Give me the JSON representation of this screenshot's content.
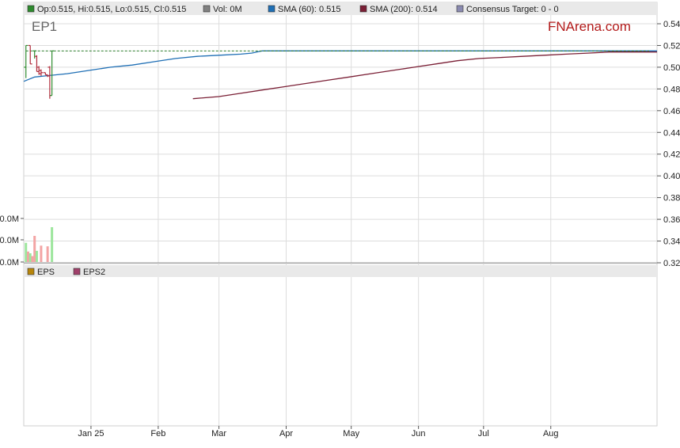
{
  "chart_data": {
    "type": "candlestick",
    "ticker": "EP1",
    "brand": "FNArena.com",
    "legend_main": [
      {
        "label": "Op:0.515, Hi:0.515, Lo:0.515, Cl:0.515",
        "color": "#2e8b2e"
      },
      {
        "label": "Vol: 0M",
        "color": "#808080"
      },
      {
        "label": "SMA (60): 0.515",
        "color": "#1f6fb5"
      },
      {
        "label": "SMA (200): 0.514",
        "color": "#7a1f35"
      },
      {
        "label": "Consensus Target: 0 - 0",
        "color": "#8a8ab0"
      }
    ],
    "legend_lower": [
      {
        "label": "EPS",
        "color": "#b8860b"
      },
      {
        "label": "EPS2",
        "color": "#a0406a"
      }
    ],
    "price_axis": {
      "ticks": [
        "0.54",
        "0.52",
        "0.50",
        "0.48",
        "0.46",
        "0.44",
        "0.42",
        "0.40",
        "0.38",
        "0.36",
        "0.34",
        "0.32"
      ],
      "range": [
        0.32,
        0.54
      ]
    },
    "volume_axis": {
      "ticks": [
        "0.0M",
        "0.0M",
        "0.0M"
      ]
    },
    "x_axis": {
      "labels": [
        "Jan 25",
        "Feb",
        "Mar",
        "Apr",
        "May",
        "Jun",
        "Jul",
        "Aug"
      ],
      "label_day": [
        31,
        62,
        90,
        121,
        151,
        182,
        212,
        243
      ]
    },
    "x_range_days": [
      0,
      292
    ],
    "candles": [
      {
        "day": 1,
        "o": 0.5,
        "h": 0.52,
        "l": 0.49,
        "c": 0.52
      },
      {
        "day": 3,
        "o": 0.52,
        "h": 0.52,
        "l": 0.503,
        "c": 0.503
      },
      {
        "day": 5,
        "o": 0.515,
        "h": 0.515,
        "l": 0.508,
        "c": 0.515
      },
      {
        "day": 6,
        "o": 0.51,
        "h": 0.511,
        "l": 0.496,
        "c": 0.496
      },
      {
        "day": 7,
        "o": 0.5,
        "h": 0.501,
        "l": 0.493,
        "c": 0.494
      },
      {
        "day": 8,
        "o": 0.497,
        "h": 0.498,
        "l": 0.492,
        "c": 0.495
      },
      {
        "day": 10,
        "o": 0.495,
        "h": 0.495,
        "l": 0.493,
        "c": 0.493
      },
      {
        "day": 11,
        "o": 0.493,
        "h": 0.493,
        "l": 0.491,
        "c": 0.492
      },
      {
        "day": 12,
        "o": 0.5,
        "h": 0.501,
        "l": 0.471,
        "c": 0.474
      },
      {
        "day": 13,
        "o": 0.474,
        "h": 0.515,
        "l": 0.474,
        "c": 0.515
      }
    ],
    "volumes": [
      {
        "day": 1,
        "v": 0.55,
        "up": true
      },
      {
        "day": 2,
        "v": 0.3,
        "up": false
      },
      {
        "day": 3,
        "v": 0.25,
        "up": true
      },
      {
        "day": 4,
        "v": 0.17,
        "up": false
      },
      {
        "day": 5,
        "v": 0.75,
        "up": false
      },
      {
        "day": 6,
        "v": 0.32,
        "up": true
      },
      {
        "day": 8,
        "v": 0.47,
        "up": false
      },
      {
        "day": 11,
        "v": 0.45,
        "up": false
      },
      {
        "day": 13,
        "v": 1.0,
        "up": true
      }
    ],
    "target_line": {
      "value": 0.515,
      "from_day": 1,
      "color": "#2e7d2e"
    },
    "sma60": {
      "color": "#1f6fb5",
      "points": [
        [
          0,
          0.487
        ],
        [
          5,
          0.491
        ],
        [
          10,
          0.492
        ],
        [
          20,
          0.494
        ],
        [
          30,
          0.497
        ],
        [
          40,
          0.5
        ],
        [
          50,
          0.502
        ],
        [
          60,
          0.505
        ],
        [
          70,
          0.508
        ],
        [
          80,
          0.51
        ],
        [
          90,
          0.511
        ],
        [
          100,
          0.512
        ],
        [
          105,
          0.513
        ],
        [
          110,
          0.515
        ],
        [
          292,
          0.515
        ]
      ]
    },
    "sma200": {
      "color": "#7a1f35",
      "points": [
        [
          78,
          0.471
        ],
        [
          90,
          0.473
        ],
        [
          100,
          0.476
        ],
        [
          110,
          0.479
        ],
        [
          120,
          0.482
        ],
        [
          130,
          0.485
        ],
        [
          140,
          0.488
        ],
        [
          150,
          0.491
        ],
        [
          160,
          0.494
        ],
        [
          170,
          0.497
        ],
        [
          180,
          0.5
        ],
        [
          190,
          0.503
        ],
        [
          200,
          0.506
        ],
        [
          210,
          0.508
        ],
        [
          220,
          0.509
        ],
        [
          230,
          0.51
        ],
        [
          240,
          0.511
        ],
        [
          250,
          0.512
        ],
        [
          260,
          0.513
        ],
        [
          270,
          0.514
        ],
        [
          292,
          0.514
        ]
      ]
    },
    "colors": {
      "up": "#2e8b2e",
      "down": "#b02a3a",
      "vol_up": "#9de69d",
      "vol_down": "#f3a4a4",
      "grid": "#dddddd"
    }
  }
}
